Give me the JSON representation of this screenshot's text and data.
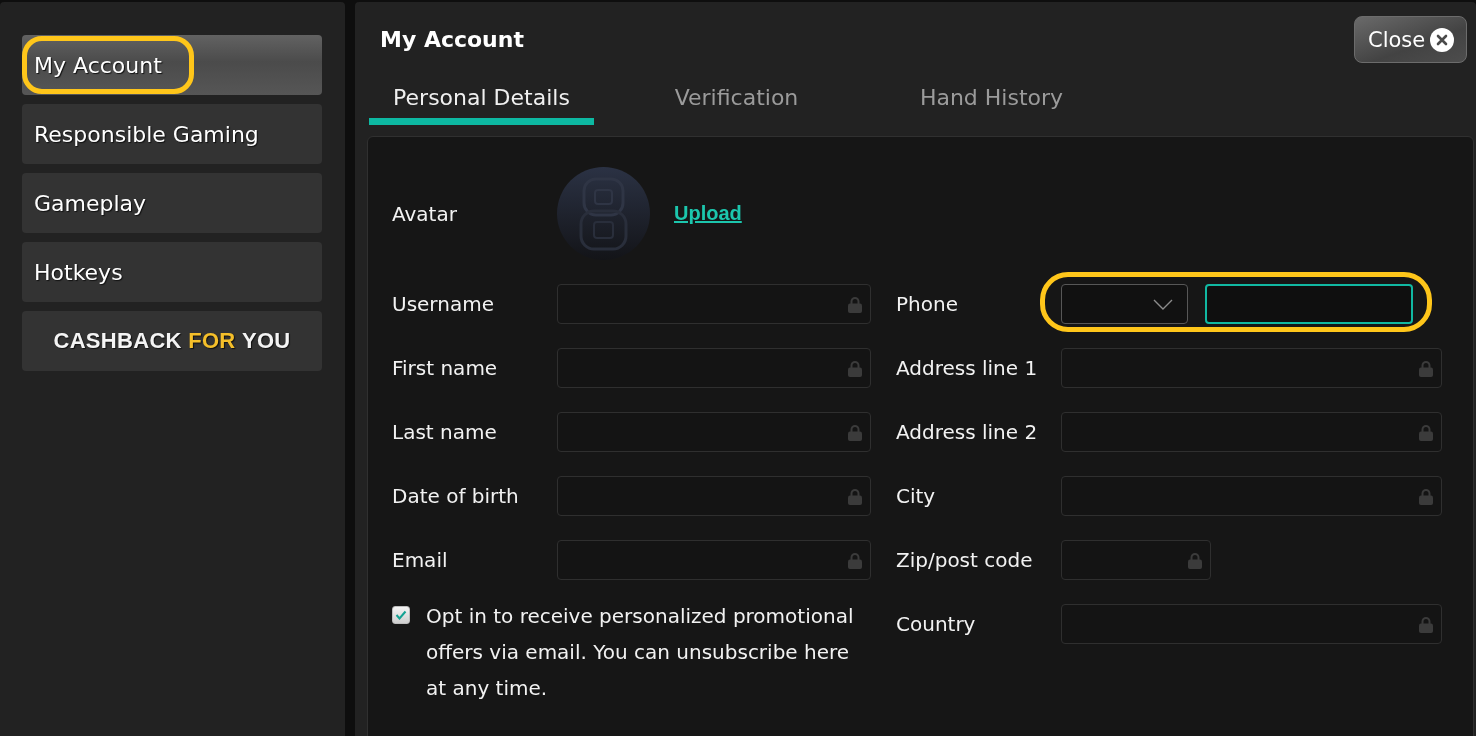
{
  "sidebar": {
    "items": [
      {
        "kind": "link",
        "label": "My Account",
        "selected": true,
        "highlighted": true
      },
      {
        "kind": "link",
        "label": "Responsible Gaming",
        "selected": false,
        "highlighted": false
      },
      {
        "kind": "link",
        "label": "Gameplay",
        "selected": false,
        "highlighted": false
      },
      {
        "kind": "link",
        "label": "Hotkeys",
        "selected": false,
        "highlighted": false
      },
      {
        "kind": "promo",
        "selected": false,
        "highlighted": false,
        "words": [
          {
            "text": "CASHBACK",
            "accent": false
          },
          {
            "text": "FOR",
            "accent": true
          },
          {
            "text": "YOU",
            "accent": false
          }
        ]
      }
    ]
  },
  "dialog": {
    "title": "My Account",
    "close_button": "Close"
  },
  "tabs": [
    {
      "label": "Personal Details",
      "selected": true
    },
    {
      "label": "Verification",
      "selected": false
    },
    {
      "label": "Hand History",
      "selected": false
    }
  ],
  "avatar": {
    "label": "Avatar",
    "upload_link": "Upload"
  },
  "left_fields": [
    {
      "label": "Username",
      "kind": "text",
      "locked": true,
      "focused": false,
      "highlighted": false
    },
    {
      "label": "First name",
      "kind": "text",
      "locked": true,
      "focused": false,
      "highlighted": false
    },
    {
      "label": "Last name",
      "kind": "text",
      "locked": true,
      "focused": false,
      "highlighted": false
    },
    {
      "label": "Date of birth",
      "kind": "text",
      "locked": true,
      "focused": false,
      "highlighted": false
    },
    {
      "label": "Email",
      "kind": "text",
      "locked": true,
      "focused": false,
      "highlighted": false
    }
  ],
  "opt_in": {
    "checked": true,
    "text": "Opt in to receive personalized promotional offers via email. You can unsubscribe here at any time."
  },
  "right_fields": [
    {
      "label": "Phone",
      "kind": "phone",
      "locked": false,
      "focused": true,
      "highlighted": true
    },
    {
      "label": "Address line 1",
      "kind": "text",
      "locked": true,
      "focused": false,
      "highlighted": false
    },
    {
      "label": "Address line 2",
      "kind": "text",
      "locked": true,
      "focused": false,
      "highlighted": false
    },
    {
      "label": "City",
      "kind": "text",
      "locked": true,
      "focused": false,
      "highlighted": false
    },
    {
      "label": "Zip/post code",
      "kind": "short",
      "locked": true,
      "focused": false,
      "highlighted": false
    },
    {
      "label": "Country",
      "kind": "text",
      "locked": true,
      "focused": false,
      "highlighted": false
    }
  ]
}
